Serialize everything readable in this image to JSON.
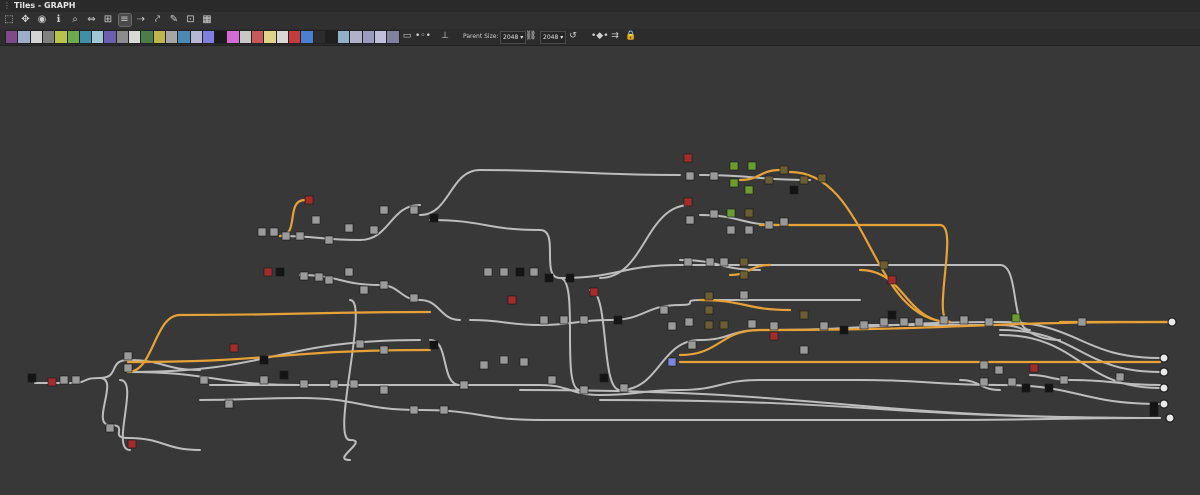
{
  "window": {
    "title": "Tiles - GRAPH"
  },
  "toolbar": {
    "tools": [
      {
        "name": "frame-all-icon",
        "glyph": "⬚"
      },
      {
        "name": "move-icon",
        "glyph": "✥"
      },
      {
        "name": "screenshot-icon",
        "glyph": "◉"
      },
      {
        "name": "info-icon",
        "glyph": "ℹ"
      },
      {
        "name": "search-icon",
        "glyph": "⌕"
      },
      {
        "name": "connect-icon",
        "glyph": "⇔"
      },
      {
        "name": "layout-icon",
        "glyph": "⊞"
      },
      {
        "name": "align-icon",
        "glyph": "≡"
      },
      {
        "name": "link-icon",
        "glyph": "⇢"
      },
      {
        "name": "split-link-icon",
        "glyph": "⤤"
      },
      {
        "name": "tools-icon",
        "glyph": "✎"
      },
      {
        "name": "snap-icon",
        "glyph": "⊡"
      },
      {
        "name": "grid-icon",
        "glyph": "▦"
      }
    ]
  },
  "atoms": [
    {
      "name": "bitmap-atom-icon",
      "color": "#7e4a8a"
    },
    {
      "name": "svg-atom-icon",
      "color": "#9bb0c8"
    },
    {
      "name": "uniform-color-atom-icon",
      "color": "#d4d4d4"
    },
    {
      "name": "gradient-atom-icon",
      "color": "#808080"
    },
    {
      "name": "blend-atom-icon",
      "color": "#b8c34a"
    },
    {
      "name": "blur-atom-icon",
      "color": "#6faa4a"
    },
    {
      "name": "channels-atom-icon",
      "color": "#3f8fa8"
    },
    {
      "name": "curve-atom-icon",
      "color": "#9ec8d6"
    },
    {
      "name": "directional-atom-icon",
      "color": "#6b5fb0"
    },
    {
      "name": "distance-atom-icon",
      "color": "#8c8c8c"
    },
    {
      "name": "emboss-atom-icon",
      "color": "#d8d8d8"
    },
    {
      "name": "fx-map-atom-icon",
      "color": "#4b7c4a"
    },
    {
      "name": "gradient-map-atom-icon",
      "color": "#bfb54a"
    },
    {
      "name": "grayscale-atom-icon",
      "color": "#a6a6a6"
    },
    {
      "name": "hsl-atom-icon",
      "color": "#4a8ab5"
    },
    {
      "name": "levels-atom-icon",
      "color": "#b7b7d4"
    },
    {
      "name": "normal-atom-icon",
      "color": "#7f7fe0"
    },
    {
      "name": "pixel-processor-atom-icon",
      "color": "#1a1a1a"
    },
    {
      "name": "sharpen-atom-icon",
      "color": "#d46ad4"
    },
    {
      "name": "shuffle-atom-icon",
      "color": "#c8c8c8"
    },
    {
      "name": "text-atom-icon",
      "color": "#c95858"
    },
    {
      "name": "transform-atom-icon",
      "color": "#e0d38a"
    },
    {
      "name": "warp-atom-icon",
      "color": "#d8d8d8"
    },
    {
      "name": "input-atom-icon",
      "color": "#c53a3a"
    },
    {
      "name": "output-atom-icon",
      "color": "#4c7fd1"
    },
    {
      "name": "value-processor-atom-icon",
      "color": "#2c2c2c"
    },
    {
      "name": "switch-atom-icon",
      "color": "#202020"
    },
    {
      "name": "blend2-atom-icon",
      "color": "#8fb0c8"
    },
    {
      "name": "edge-atom-icon",
      "color": "#b0b0c8"
    },
    {
      "name": "mask-atom-icon",
      "color": "#9b9bc0"
    },
    {
      "name": "warp2-atom-icon",
      "color": "#bfbfdb"
    },
    {
      "name": "tile-atom-icon",
      "color": "#8080a0"
    }
  ],
  "toolbar_extra": {
    "comment_icon": "comment-icon",
    "pin_icon": "pin-icon",
    "parent_size_label": "Parent Size:",
    "parent_size_value": "2048",
    "size_value": "2048",
    "chain_icon": "chain-link-icon",
    "refresh_icon": "reset-icon",
    "nav_icons": [
      "prev-node-icon",
      "next-node-icon",
      "lock-icon"
    ]
  },
  "colors": {
    "canvas": "#383838",
    "link": "#bdbdbd",
    "link_highlight": "#e6a237",
    "node": "#9a9a9a",
    "node_dark": "#141414",
    "node_red": "#a32b2b",
    "node_green": "#6a9d2e",
    "node_olive": "#6b5d34",
    "node_blue": "#7d86d9"
  }
}
